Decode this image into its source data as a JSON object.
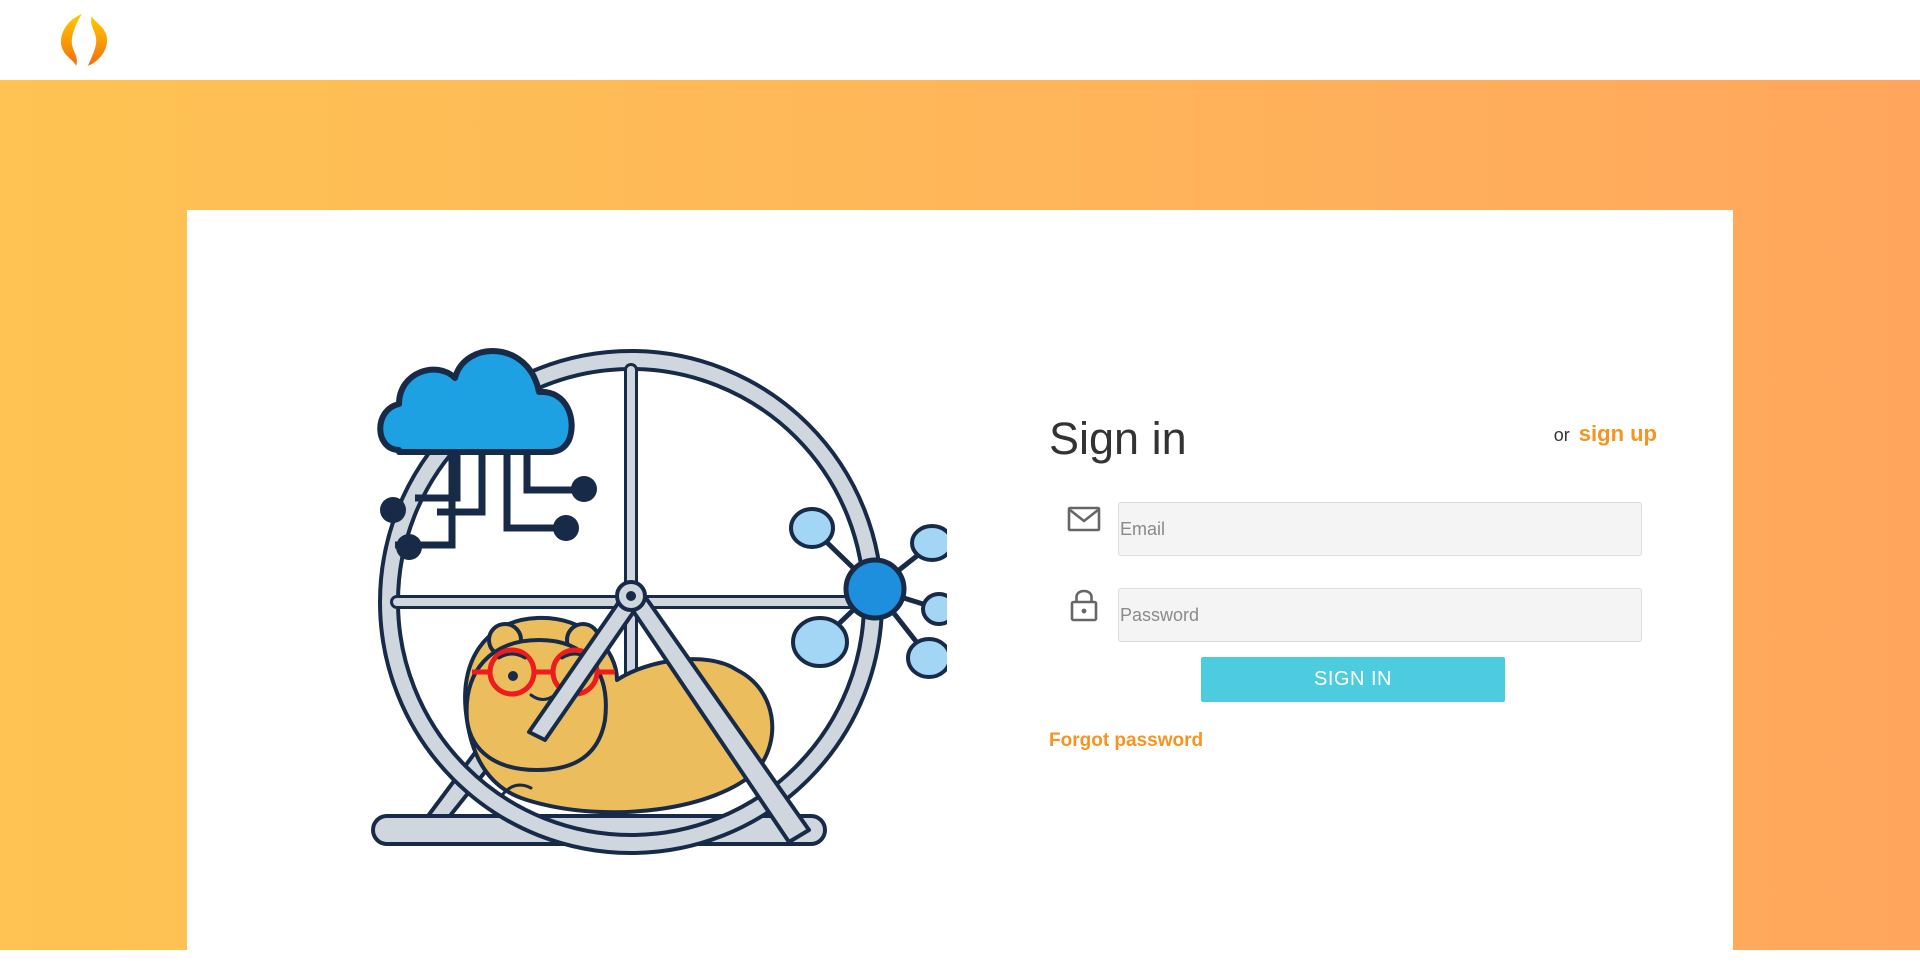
{
  "header": {
    "logo_icon": "brand-flame-logo-icon"
  },
  "colors": {
    "accent": "#f7931e",
    "button": "#4dcce0",
    "background_gradient_start": "#fec352",
    "background_gradient_end": "#ffa65c"
  },
  "signin": {
    "title": "Sign in",
    "or_text": "or",
    "signup_label": "sign up",
    "email": {
      "placeholder": "Email",
      "value": "",
      "icon": "mail-icon"
    },
    "password": {
      "placeholder": "Password",
      "value": "",
      "icon": "lock-icon"
    },
    "submit_label": "SIGN IN",
    "forgot_label": "Forgot password"
  },
  "illustration": {
    "name": "hamster-wheel-cloud-network-illustration"
  }
}
